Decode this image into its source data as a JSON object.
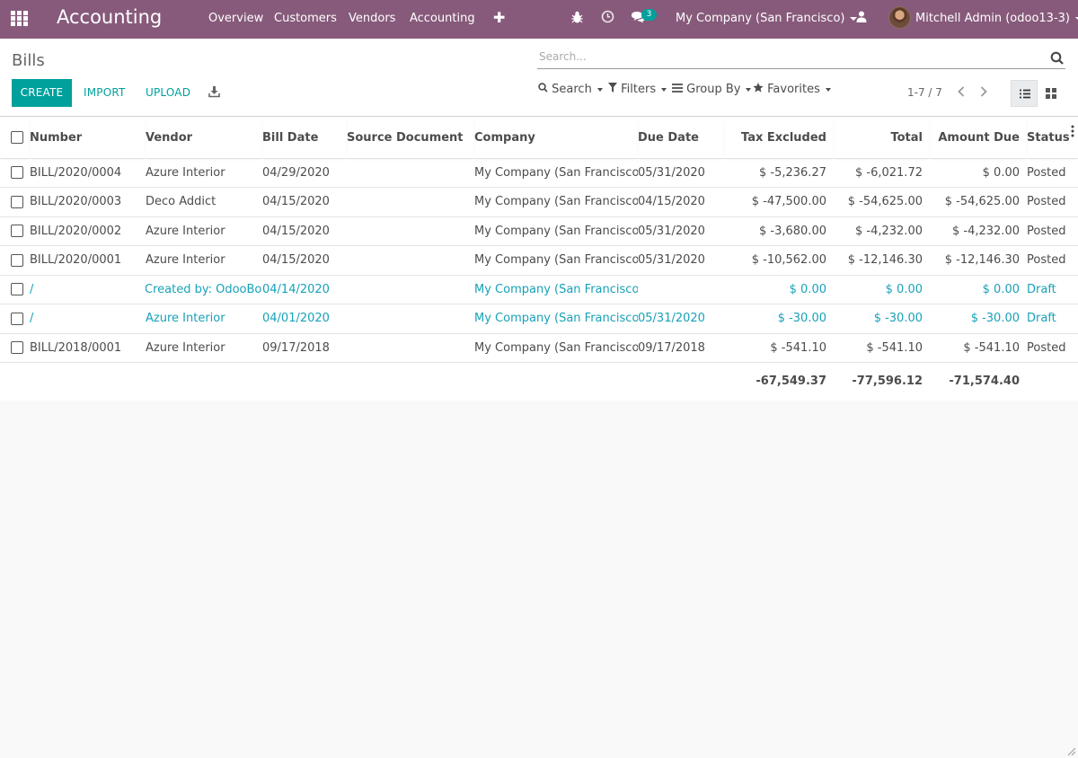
{
  "navbar": {
    "app_title": "Accounting",
    "menu": [
      "Overview",
      "Customers",
      "Vendors",
      "Accounting"
    ],
    "messages_count": "3",
    "company": "My Company (San Francisco)",
    "user": "Mitchell Admin (odoo13-3)"
  },
  "control_panel": {
    "breadcrumb": "Bills",
    "create_label": "CREATE",
    "import_label": "IMPORT",
    "upload_label": "UPLOAD",
    "search_placeholder": "Search...",
    "search_label": "Search",
    "filters_label": "Filters",
    "groupby_label": "Group By",
    "favorites_label": "Favorites",
    "pager": "1-7 / 7"
  },
  "table": {
    "columns": [
      "Number",
      "Vendor",
      "Bill Date",
      "Source Document",
      "Company",
      "Due Date",
      "Tax Excluded",
      "Total",
      "Amount Due",
      "Status"
    ],
    "rows": [
      {
        "number": "BILL/2020/0004",
        "vendor": "Azure Interior",
        "bill_date": "04/29/2020",
        "source": "",
        "company": "My Company (San Francisco)",
        "due_date": "05/31/2020",
        "tax_excluded": "$ -5,236.27",
        "total": "$ -6,021.72",
        "amount_due": "$ 0.00",
        "status": "Posted"
      },
      {
        "number": "BILL/2020/0003",
        "vendor": "Deco Addict",
        "bill_date": "04/15/2020",
        "source": "",
        "company": "My Company (San Francisco)",
        "due_date": "04/15/2020",
        "tax_excluded": "$ -47,500.00",
        "total": "$ -54,625.00",
        "amount_due": "$ -54,625.00",
        "status": "Posted"
      },
      {
        "number": "BILL/2020/0002",
        "vendor": "Azure Interior",
        "bill_date": "04/15/2020",
        "source": "",
        "company": "My Company (San Francisco)",
        "due_date": "05/31/2020",
        "tax_excluded": "$ -3,680.00",
        "total": "$ -4,232.00",
        "amount_due": "$ -4,232.00",
        "status": "Posted"
      },
      {
        "number": "BILL/2020/0001",
        "vendor": "Azure Interior",
        "bill_date": "04/15/2020",
        "source": "",
        "company": "My Company (San Francisco)",
        "due_date": "05/31/2020",
        "tax_excluded": "$ -10,562.00",
        "total": "$ -12,146.30",
        "amount_due": "$ -12,146.30",
        "status": "Posted"
      },
      {
        "number": "/",
        "vendor": "Created by: OdooBot",
        "vendor_prefix": "#",
        "bill_date": "04/14/2020",
        "source": "",
        "company": "My Company (San Francisco)",
        "due_date": "",
        "tax_excluded": "$ 0.00",
        "total": "$ 0.00",
        "amount_due": "$ 0.00",
        "status": "Draft"
      },
      {
        "number": "/",
        "vendor": "Azure Interior",
        "bill_date": "04/01/2020",
        "source": "",
        "company": "My Company (San Francisco)",
        "due_date": "05/31/2020",
        "tax_excluded": "$ -30.00",
        "total": "$ -30.00",
        "amount_due": "$ -30.00",
        "status": "Draft"
      },
      {
        "number": "BILL/2018/0001",
        "vendor": "Azure Interior",
        "bill_date": "09/17/2018",
        "source": "",
        "company": "My Company (San Francisco)",
        "due_date": "09/17/2018",
        "tax_excluded": "$ -541.10",
        "total": "$ -541.10",
        "amount_due": "$ -541.10",
        "status": "Posted"
      }
    ],
    "totals": {
      "tax_excluded": "-67,549.37",
      "total": "-77,596.12",
      "amount_due": "-71,574.40"
    }
  },
  "colors": {
    "navbar": "#875a7b",
    "primary": "#00a09d",
    "draft_text": "#17a2b8"
  }
}
